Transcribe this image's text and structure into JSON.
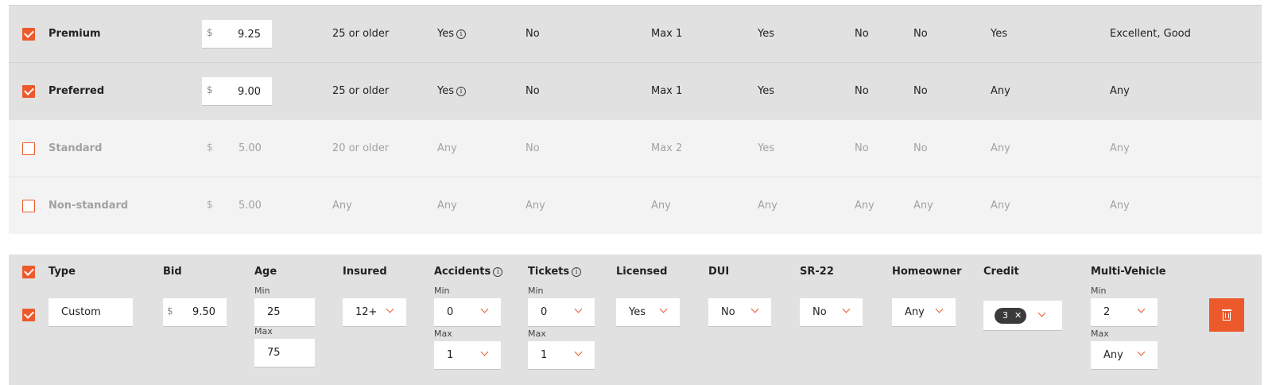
{
  "tiers": [
    {
      "name": "Premium",
      "enabled": true,
      "currency": "$",
      "bid": "9.25",
      "age": "25 or older",
      "insured": "Yes",
      "accidents": "No",
      "tickets": "Max 1",
      "licensed": "Yes",
      "dui": "No",
      "sr22": "No",
      "homeowner": "Yes",
      "credit": "Excellent, Good"
    },
    {
      "name": "Preferred",
      "enabled": true,
      "currency": "$",
      "bid": "9.00",
      "age": "25 or older",
      "insured": "Yes",
      "accidents": "No",
      "tickets": "Max 1",
      "licensed": "Yes",
      "dui": "No",
      "sr22": "No",
      "homeowner": "Any",
      "credit": "Any"
    },
    {
      "name": "Standard",
      "enabled": false,
      "currency": "$",
      "bid": "5.00",
      "age": "20 or older",
      "insured": "Any",
      "accidents": "No",
      "tickets": "Max 2",
      "licensed": "Yes",
      "dui": "No",
      "sr22": "No",
      "homeowner": "Any",
      "credit": "Any"
    },
    {
      "name": "Non-standard",
      "enabled": false,
      "currency": "$",
      "bid": "5.00",
      "age": "Any",
      "insured": "Any",
      "accidents": "Any",
      "tickets": "Any",
      "licensed": "Any",
      "dui": "Any",
      "sr22": "Any",
      "homeowner": "Any",
      "credit": "Any"
    }
  ],
  "custom": {
    "headers": {
      "type": "Type",
      "bid": "Bid",
      "age": "Age",
      "insured": "Insured",
      "accidents": "Accidents",
      "tickets": "Tickets",
      "licensed": "Licensed",
      "dui": "DUI",
      "sr22": "SR-22",
      "homeowner": "Homeowner",
      "credit": "Credit",
      "multi_vehicle": "Multi-Vehicle"
    },
    "min_label": "Min",
    "max_label": "Max",
    "enabled": true,
    "type_value": "Custom",
    "currency": "$",
    "bid": "9.50",
    "age_min": "25",
    "age_max": "75",
    "insured": "12+",
    "accidents_min": "0",
    "accidents_max": "1",
    "tickets_min": "0",
    "tickets_max": "1",
    "licensed": "Yes",
    "dui": "No",
    "sr22": "No",
    "homeowner": "Any",
    "credit_selected_count": "3",
    "multi_vehicle_min": "2",
    "multi_vehicle_max": "Any"
  },
  "icons": {
    "info": "info-icon",
    "chevron": "chevron-down-icon",
    "trash": "trash-icon",
    "remove": "close-icon"
  },
  "colors": {
    "accent": "#ec5a2c",
    "active_row": "#e1e1e1",
    "inactive_row": "#f3f3f3",
    "pill": "#3a3a3a"
  }
}
